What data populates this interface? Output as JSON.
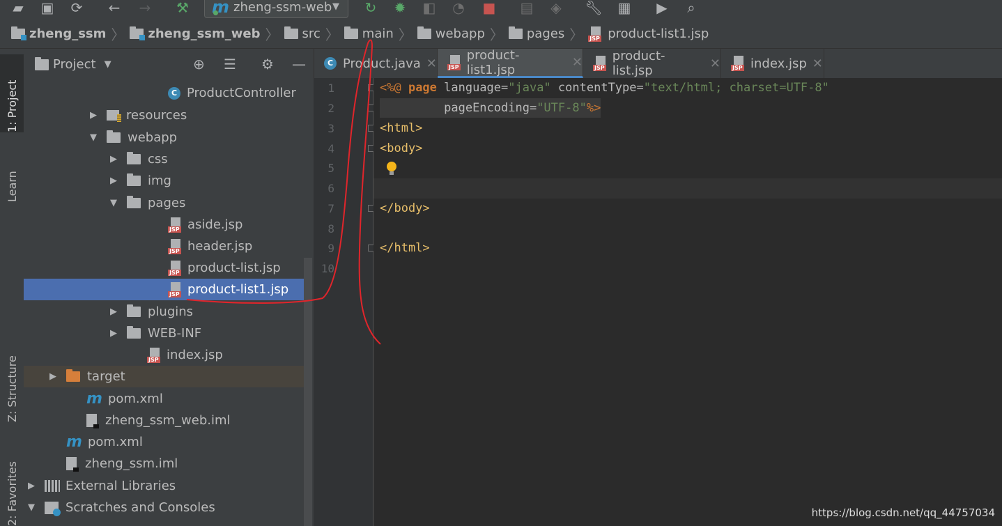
{
  "toolbar": {
    "run_config": "zheng-ssm-web"
  },
  "breadcrumb": [
    "zheng_ssm",
    "zheng_ssm_web",
    "src",
    "main",
    "webapp",
    "pages",
    "product-list1.jsp"
  ],
  "tool_windows": {
    "project": "1: Project",
    "learn": "Learn",
    "structure": "Z: Structure",
    "favorites": "2: Favorites"
  },
  "project_panel": {
    "title": "Project",
    "tree": [
      {
        "label": "ProductController",
        "icon": "class-icon"
      },
      {
        "label": "resources",
        "icon": "resources-folder-icon",
        "arrow": "▶"
      },
      {
        "label": "webapp",
        "icon": "folder-icon",
        "arrow": "▼"
      },
      {
        "label": "css",
        "icon": "folder-icon",
        "arrow": "▶"
      },
      {
        "label": "img",
        "icon": "folder-icon",
        "arrow": "▶"
      },
      {
        "label": "pages",
        "icon": "folder-icon",
        "arrow": "▼"
      },
      {
        "label": "aside.jsp",
        "icon": "jsp-file-icon"
      },
      {
        "label": "header.jsp",
        "icon": "jsp-file-icon"
      },
      {
        "label": "product-list.jsp",
        "icon": "jsp-file-icon"
      },
      {
        "label": "product-list1.jsp",
        "icon": "jsp-file-icon",
        "selected": true
      },
      {
        "label": "plugins",
        "icon": "folder-icon",
        "arrow": "▶"
      },
      {
        "label": "WEB-INF",
        "icon": "folder-icon",
        "arrow": "▶"
      },
      {
        "label": "index.jsp",
        "icon": "jsp-file-icon"
      },
      {
        "label": "target",
        "icon": "excluded-folder-icon",
        "arrow": "▶"
      },
      {
        "label": "pom.xml",
        "icon": "maven-icon"
      },
      {
        "label": "zheng_ssm_web.iml",
        "icon": "iml-file-icon"
      },
      {
        "label": "pom.xml",
        "icon": "maven-icon"
      },
      {
        "label": "zheng_ssm.iml",
        "icon": "iml-file-icon"
      },
      {
        "label": "External Libraries",
        "icon": "library-icon",
        "arrow": "▶"
      },
      {
        "label": "Scratches and Consoles",
        "icon": "scratches-icon",
        "arrow": "▼"
      }
    ]
  },
  "editor": {
    "tabs": [
      "Product.java",
      "product-list1.jsp",
      "product-list.jsp",
      "index.jsp"
    ],
    "active_tab": "product-list1.jsp",
    "line_numbers": [
      "1",
      "2",
      "3",
      "4",
      "5",
      "6",
      "7",
      "8",
      "9",
      "10"
    ],
    "code": {
      "l1_open": "<%@ ",
      "l1_page": "page",
      "l1_lang_attr": " language=",
      "l1_lang_val": "\"java\"",
      "l1_ct_attr": " contentType=",
      "l1_ct_val": "\"text/html; charset=UTF-8\"",
      "l2_indent": "         ",
      "l2_attr": "pageEncoding=",
      "l2_val": "\"UTF-8\"",
      "l2_close": "%>",
      "l3": "<html>",
      "l4": "<body>",
      "l7": "</body>",
      "l9": "</html>"
    }
  },
  "colors": {
    "accent": "#4b6eaf",
    "keyword": "#cc7832",
    "tag": "#e8bf6a",
    "string": "#6a8759",
    "annotation_line": "#e0252b"
  },
  "watermark": "https://blog.csdn.net/qq_44757034"
}
